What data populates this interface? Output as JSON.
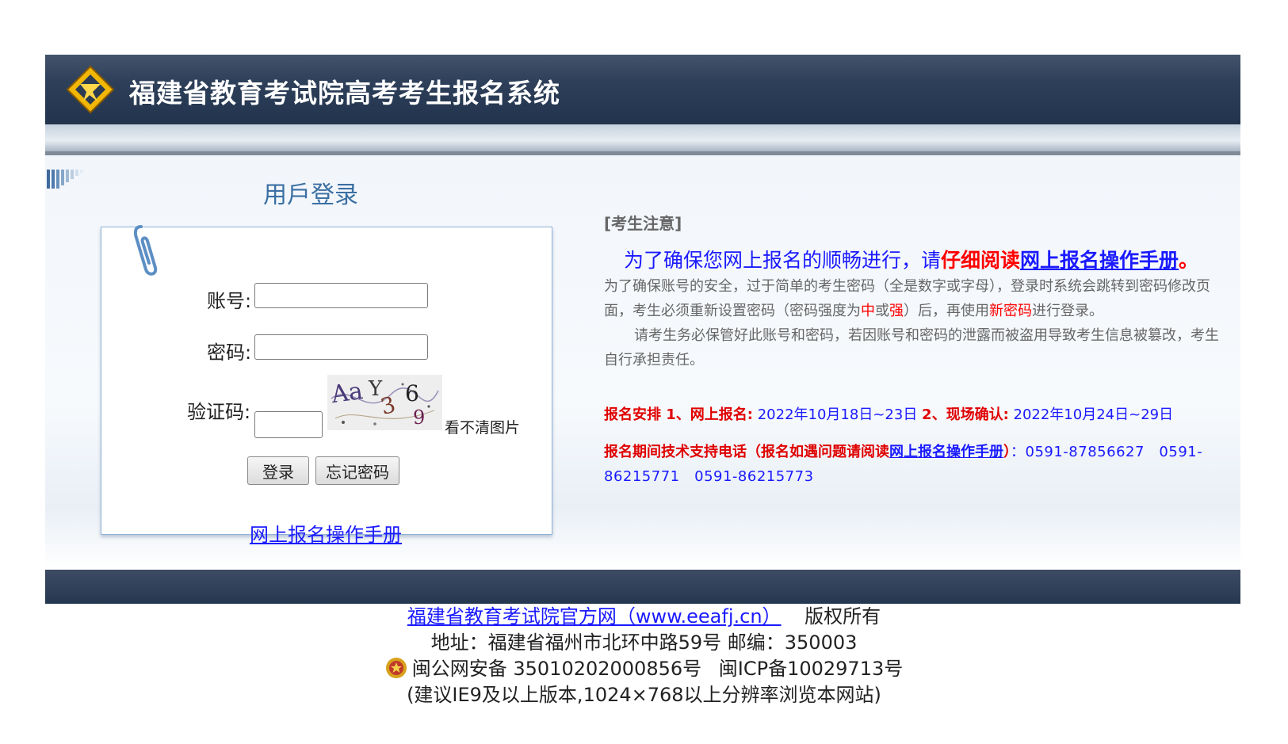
{
  "header": {
    "title": "福建省教育考试院高考考生报名系统"
  },
  "login": {
    "title": "用戶登录",
    "account_label": "账号:",
    "account_value": "",
    "password_label": "密码:",
    "password_value": "",
    "captcha_label": "验证码:",
    "captcha_value": "",
    "captcha_text": "AaY36 9",
    "captcha_refresh": "看不清图片",
    "login_button": "登录",
    "forgot_button": "忘记密码",
    "manual_link": "网上报名操作手册"
  },
  "notice": {
    "heading": "[考生注意]",
    "lead_blue": "为了确保您网上报名的顺畅进行，请",
    "lead_red": "仔细阅读",
    "lead_link": "网上报名操作手册",
    "lead_end": "。",
    "p1_a": "为了确保账号的安全，过于简单的考生密码（全是数字或字母），登录时系统会跳转到密码修改页面，考生必须重新设置密码（密码强度为",
    "p1_mid": "中",
    "p1_or": "或",
    "p1_strong": "强",
    "p1_b": "）后，再使用",
    "p1_new": "新密码",
    "p1_c": "进行登录。",
    "p2": "请考生务必保管好此账号和密码，若因账号和密码的泄露而被盗用导致考生信息被篡改，考生自行承担责任。",
    "schedule_label": "报名安排 1、网上报名:",
    "schedule_online": " 2022年10月18日~23日 ",
    "schedule_label2": "2、现场确认:",
    "schedule_confirm": " 2022年10月24日~29日",
    "support_label": "报名期间技术支持电话（报名如遇问题请阅读",
    "support_link": "网上报名操作手册",
    "support_close": "）",
    "support_phones": "：0591-87856627　0591-86215771　0591-86215773"
  },
  "footer": {
    "site_link": "福建省教育考试院官方网（www.eeafj.cn）",
    "rights": "版权所有",
    "address": "地址：福建省福州市北环中路59号 邮编：350003",
    "police": "闽公网安备 35010202000856号",
    "icp": "闽ICP备10029713号",
    "recommend": "(建议IE9及以上版本,1024×768以上分辨率浏览本网站)"
  },
  "colors": {
    "header_dark": "#22344d",
    "link_blue": "#1a1aff",
    "alert_red": "#e00000",
    "title_blue": "#3b6fa3"
  },
  "icons": [
    "logo-icon",
    "bars-icon",
    "paperclip-icon",
    "police-badge-icon"
  ]
}
